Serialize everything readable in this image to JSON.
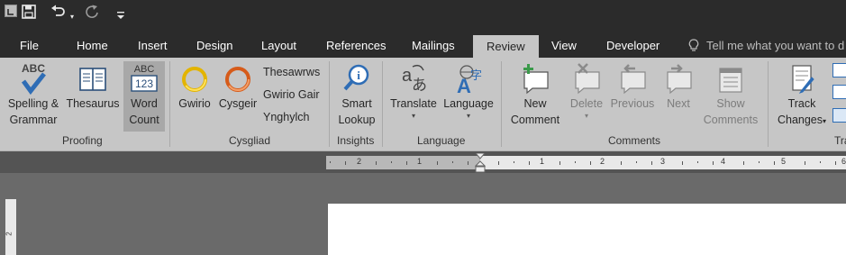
{
  "qat": {
    "save_icon": "save-icon",
    "undo_icon": "undo-icon",
    "redo_icon": "redo-icon",
    "customize_icon": "customize-icon"
  },
  "tabs": [
    "File",
    "Home",
    "Insert",
    "Design",
    "Layout",
    "References",
    "Mailings",
    "Review",
    "View",
    "Developer"
  ],
  "active_tab": "Review",
  "tell_me": "Tell me what you want to d",
  "proofing": {
    "spelling_1": "Spelling &",
    "spelling_2": "Grammar",
    "spelling_icon_text": "ABC",
    "thesaurus": "Thesaurus",
    "wordcount_1": "Word",
    "wordcount_2": "Count",
    "wordcount_abc": "ABC",
    "wordcount_123": "123",
    "group": "Proofing"
  },
  "cysgliad": {
    "gwirio": "Gwirio",
    "cysgeir": "Cysgeir",
    "thesawrws": "Thesawrws",
    "gwirio_gair": "Gwirio Gair",
    "ynghylch": "Ynghylch",
    "group": "Cysgliad"
  },
  "insights": {
    "smart_1": "Smart",
    "smart_2": "Lookup",
    "group": "Insights"
  },
  "language": {
    "translate": "Translate",
    "language": "Language",
    "group": "Language"
  },
  "comments": {
    "new_1": "New",
    "new_2": "Comment",
    "delete": "Delete",
    "previous": "Previous",
    "next": "Next",
    "show_1": "Show",
    "show_2": "Comments",
    "group": "Comments"
  },
  "tracking": {
    "track_1": "Track",
    "track_2": "Changes",
    "group": "Tra"
  },
  "ruler": {
    "left_labels": [
      "2",
      "1"
    ],
    "right_labels": [
      "1",
      "2",
      "3",
      "4",
      "5",
      "6"
    ],
    "vertical_label": "2"
  },
  "colors": {
    "titlebar": "#2b2b2b",
    "ribbon": "#c6c6c6",
    "workspace": "#6a6a6a",
    "accent_blue": "#2f6db5"
  }
}
